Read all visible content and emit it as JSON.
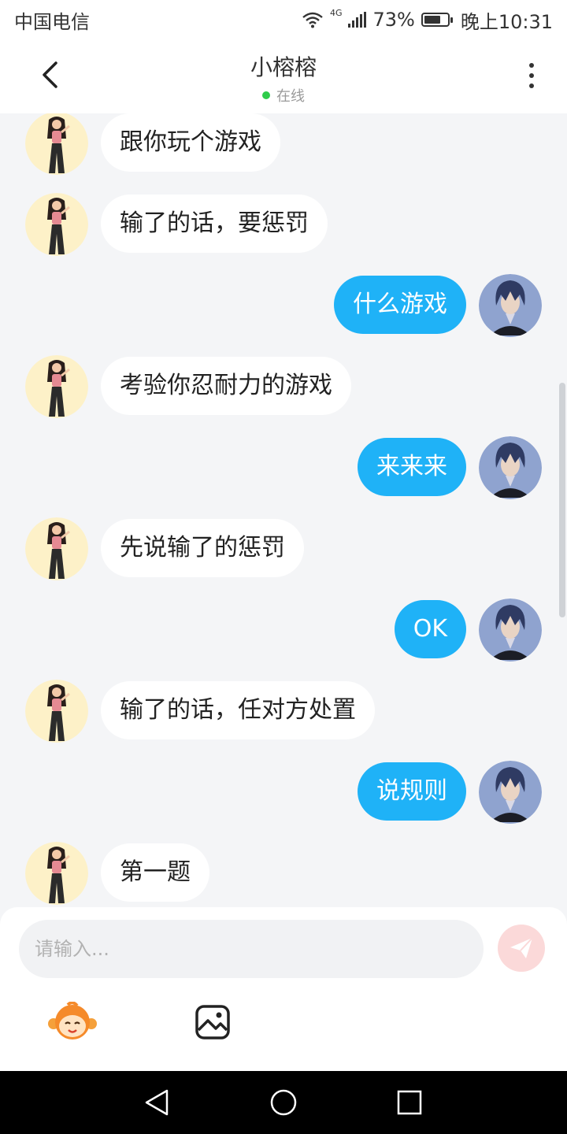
{
  "status_bar": {
    "carrier": "中国电信",
    "network": "4G",
    "battery": "73%",
    "battery_level": 0.73,
    "time": "晚上10:31"
  },
  "header": {
    "title": "小榕榕",
    "status": "在线",
    "status_color": "#2fcc4b"
  },
  "messages": [
    {
      "side": "left",
      "text": "跟你玩个游戏"
    },
    {
      "side": "left",
      "text": "输了的话，要惩罚"
    },
    {
      "side": "right",
      "text": "什么游戏"
    },
    {
      "side": "left",
      "text": "考验你忍耐力的游戏"
    },
    {
      "side": "right",
      "text": "来来来"
    },
    {
      "side": "left",
      "text": "先说输了的惩罚"
    },
    {
      "side": "right",
      "text": "OK"
    },
    {
      "side": "left",
      "text": "输了的话，任对方处置"
    },
    {
      "side": "right",
      "text": "说规则"
    },
    {
      "side": "left",
      "text": "第一题"
    }
  ],
  "composer": {
    "placeholder": "请输入...",
    "send_icon": "paper-plane-icon",
    "emoji_icon": "monkey-face-icon",
    "image_icon": "image-icon"
  },
  "colors": {
    "sent_bubble": "#1fb2f7",
    "received_bubble": "#ffffff",
    "background": "#f4f5f7"
  }
}
